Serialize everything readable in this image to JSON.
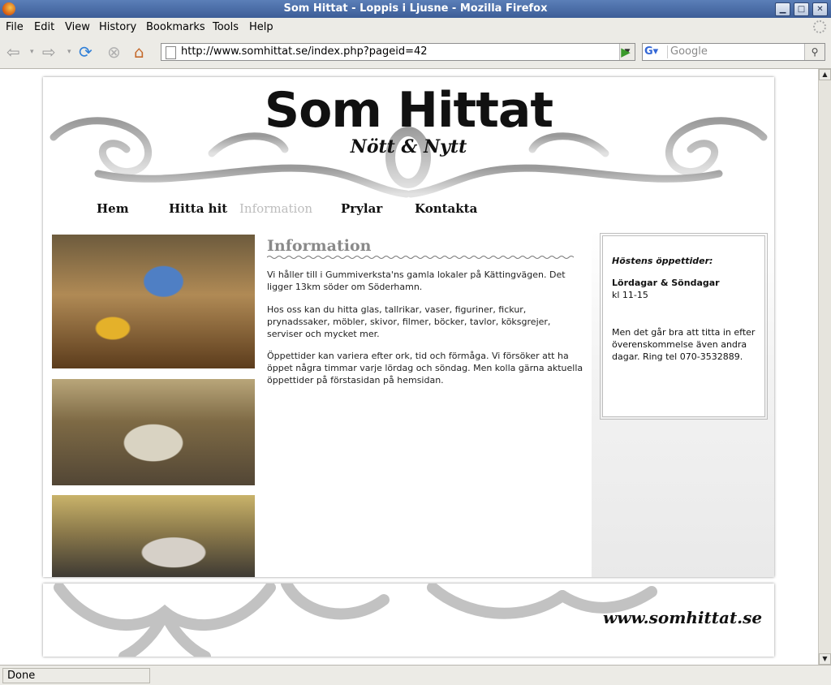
{
  "window": {
    "title": "Som Hittat - Loppis i Ljusne - Mozilla Firefox"
  },
  "menu": [
    "File",
    "Edit",
    "View",
    "History",
    "Bookmarks",
    "Tools",
    "Help"
  ],
  "toolbar": {
    "url": "http://www.somhittat.se/index.php?pageid=42",
    "search_placeholder": "Google"
  },
  "status": "Done",
  "site": {
    "logo": "Som Hittat",
    "tagline": "Nött & Nytt",
    "nav": [
      "Hem",
      "Hitta hit",
      "Information",
      "Prylar",
      "Kontakta"
    ],
    "active_nav": "Information",
    "heading": "Information",
    "paragraphs": [
      "Vi håller till i Gummiverksta'ns gamla lokaler på Kättingvägen. Det ligger 13km söder om Söderhamn.",
      "Hos oss kan du hitta glas, tallrikar, vaser, figuriner, fickur, prynadssaker, möbler, skivor, filmer, böcker, tavlor, köksgrejer, serviser och mycket mer.",
      "Öppettider kan variera efter ork, tid och förmåga. Vi försöker att ha öppet några timmar varje lördag och söndag. Men kolla gärna aktuella öppettider på förstasidan på hemsidan."
    ],
    "sidebar": {
      "heading": "Höstens öppettider:",
      "days": "Lördagar & Söndagar",
      "hours": "kl 11-15",
      "note": "Men det går bra att titta in efter överenskommelse även andra dagar. Ring tel 070-3532889."
    },
    "footer_url": "www.somhittat.se"
  },
  "colors": {
    "titlebar": "#3c5d97",
    "chrome": "#ecebe6",
    "heading": "#8a8a8a",
    "nav_active": "#bdbdbd"
  }
}
